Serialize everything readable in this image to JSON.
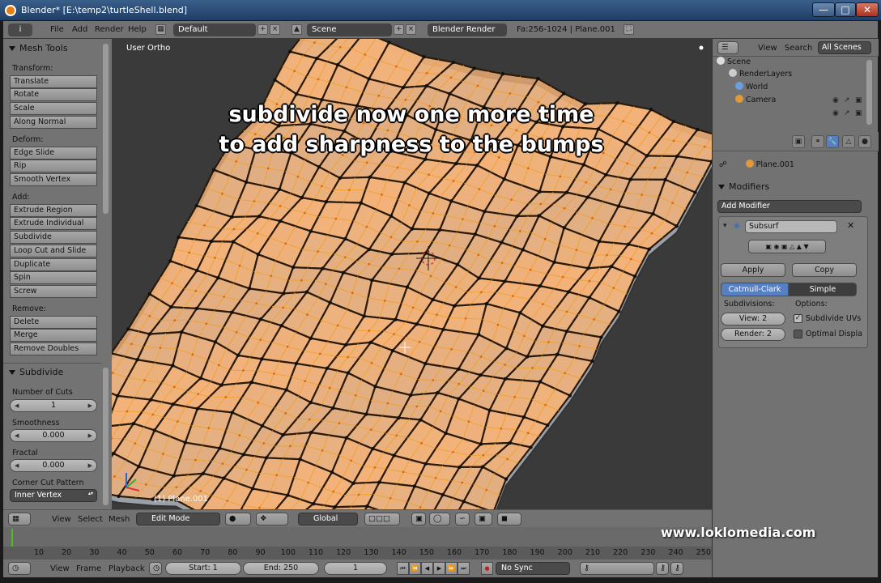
{
  "window": {
    "title": "Blender* [E:\\temp2\\turtleShell.blend]"
  },
  "info_header": {
    "editor_icon": "i",
    "menus": [
      "File",
      "Add",
      "Render",
      "Help"
    ],
    "layout": "Default",
    "scene": "Scene",
    "engine": "Blender Render",
    "stats": "Fa:256-1024 | Plane.001"
  },
  "tool_shelf": {
    "panel_title": "Mesh Tools",
    "sections": {
      "transform": {
        "label": "Transform:",
        "buttons": [
          "Translate",
          "Rotate",
          "Scale",
          "Along Normal"
        ]
      },
      "deform": {
        "label": "Deform:",
        "buttons": [
          "Edge Slide",
          "Rip",
          "Smooth Vertex"
        ]
      },
      "add": {
        "label": "Add:",
        "buttons": [
          "Extrude Region",
          "Extrude Individual",
          "Subdivide",
          "Loop Cut and Slide",
          "Duplicate",
          "Spin",
          "Screw"
        ]
      },
      "remove": {
        "label": "Remove:",
        "buttons": [
          "Delete",
          "Merge",
          "Remove Doubles"
        ]
      }
    },
    "operator": {
      "title": "Subdivide",
      "number_of_cuts_label": "Number of Cuts",
      "number_of_cuts": "1",
      "smoothness_label": "Smoothness",
      "smoothness": "0.000",
      "fractal_label": "Fractal",
      "fractal": "0.000",
      "corner_cut_label": "Corner Cut Pattern",
      "corner_cut": "Inner Vertex"
    }
  },
  "viewport": {
    "view_name": "User Ortho",
    "object_name": "(1) Plane.001",
    "overlay_line1": "subdivide now one more time",
    "overlay_line2": "to add sharpness to the bumps",
    "mesh_face_color": "#f2b27a",
    "mesh_edge_color": "#f0a020"
  },
  "viewport_header": {
    "menus": [
      "View",
      "Select",
      "Mesh"
    ],
    "mode": "Edit Mode",
    "pivot": "Global"
  },
  "timeline": {
    "ticks": [
      "10",
      "20",
      "30",
      "40",
      "50",
      "60",
      "70",
      "80",
      "90",
      "100",
      "110",
      "120",
      "130",
      "140",
      "150",
      "160",
      "170",
      "180",
      "190",
      "200",
      "210",
      "220",
      "230",
      "240",
      "250"
    ],
    "menus": [
      "View",
      "Frame",
      "Playback"
    ],
    "start": "Start: 1",
    "end": "End: 250",
    "current": "1",
    "sync": "No Sync"
  },
  "outliner": {
    "menus": [
      "View",
      "Search"
    ],
    "filter": "All Scenes",
    "items": [
      "Scene",
      "RenderLayers",
      "World",
      "Camera"
    ]
  },
  "properties": {
    "object_name": "Plane.001",
    "panel_title": "Modifiers",
    "add_modifier": "Add Modifier",
    "modifier_name": "Subsurf",
    "apply": "Apply",
    "copy": "Copy",
    "catmull": "Catmull-Clark",
    "simple": "Simple",
    "subdivisions_label": "Subdivisions:",
    "options_label": "Options:",
    "view": "View: 2",
    "render": "Render: 2",
    "subdivide_uvs": "Subdivide UVs",
    "optimal_display": "Optimal Displa"
  },
  "watermark": "www.loklomedia.com"
}
